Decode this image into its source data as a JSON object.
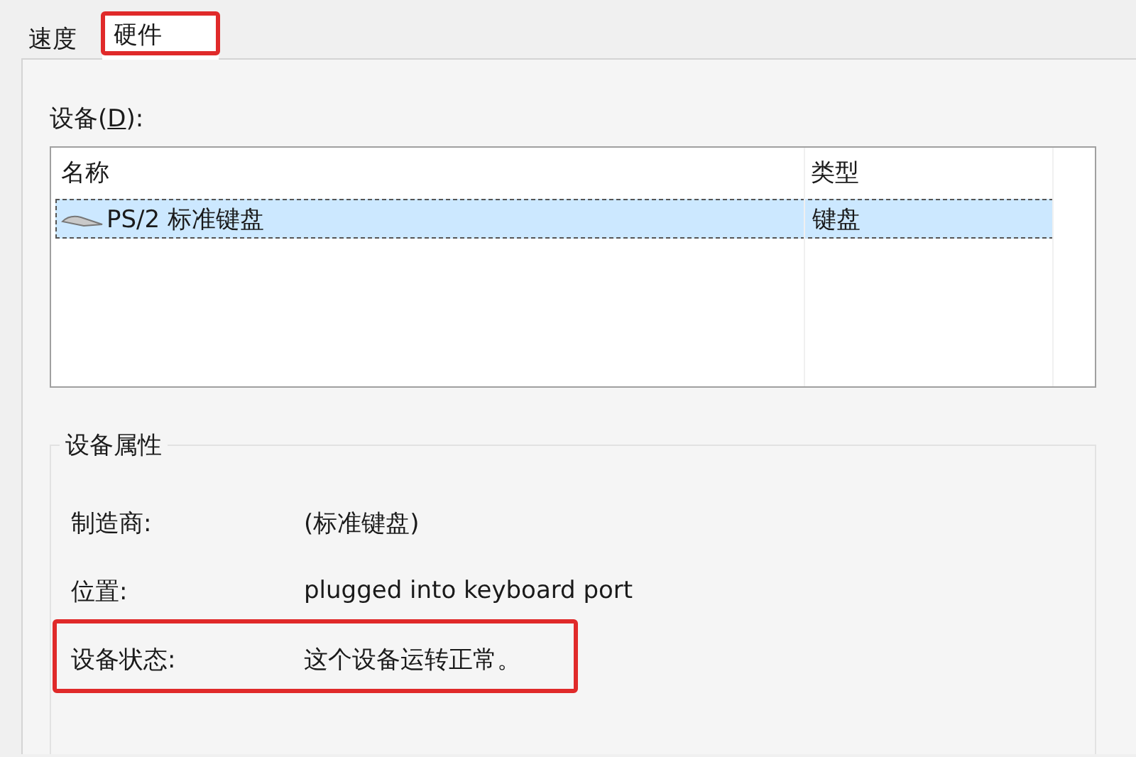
{
  "tabs": [
    {
      "label": "速度",
      "selected": false,
      "highlighted": false
    },
    {
      "label": "硬件",
      "selected": true,
      "highlighted": true
    }
  ],
  "devices": {
    "label": {
      "before": "设备(",
      "access_key": "D",
      "after": "):"
    },
    "columns": [
      "名称",
      "类型"
    ],
    "rows": [
      {
        "name": "PS/2 标准键盘",
        "type": "键盘",
        "selected": true
      }
    ]
  },
  "properties": {
    "title": "设备属性",
    "rows": [
      {
        "label": "制造商:",
        "value": "(标准键盘)",
        "highlighted": false
      },
      {
        "label": "位置:",
        "value": "plugged into keyboard port",
        "highlighted": false
      },
      {
        "label": "设备状态:",
        "value": "这个设备运转正常。",
        "highlighted": true
      }
    ]
  }
}
